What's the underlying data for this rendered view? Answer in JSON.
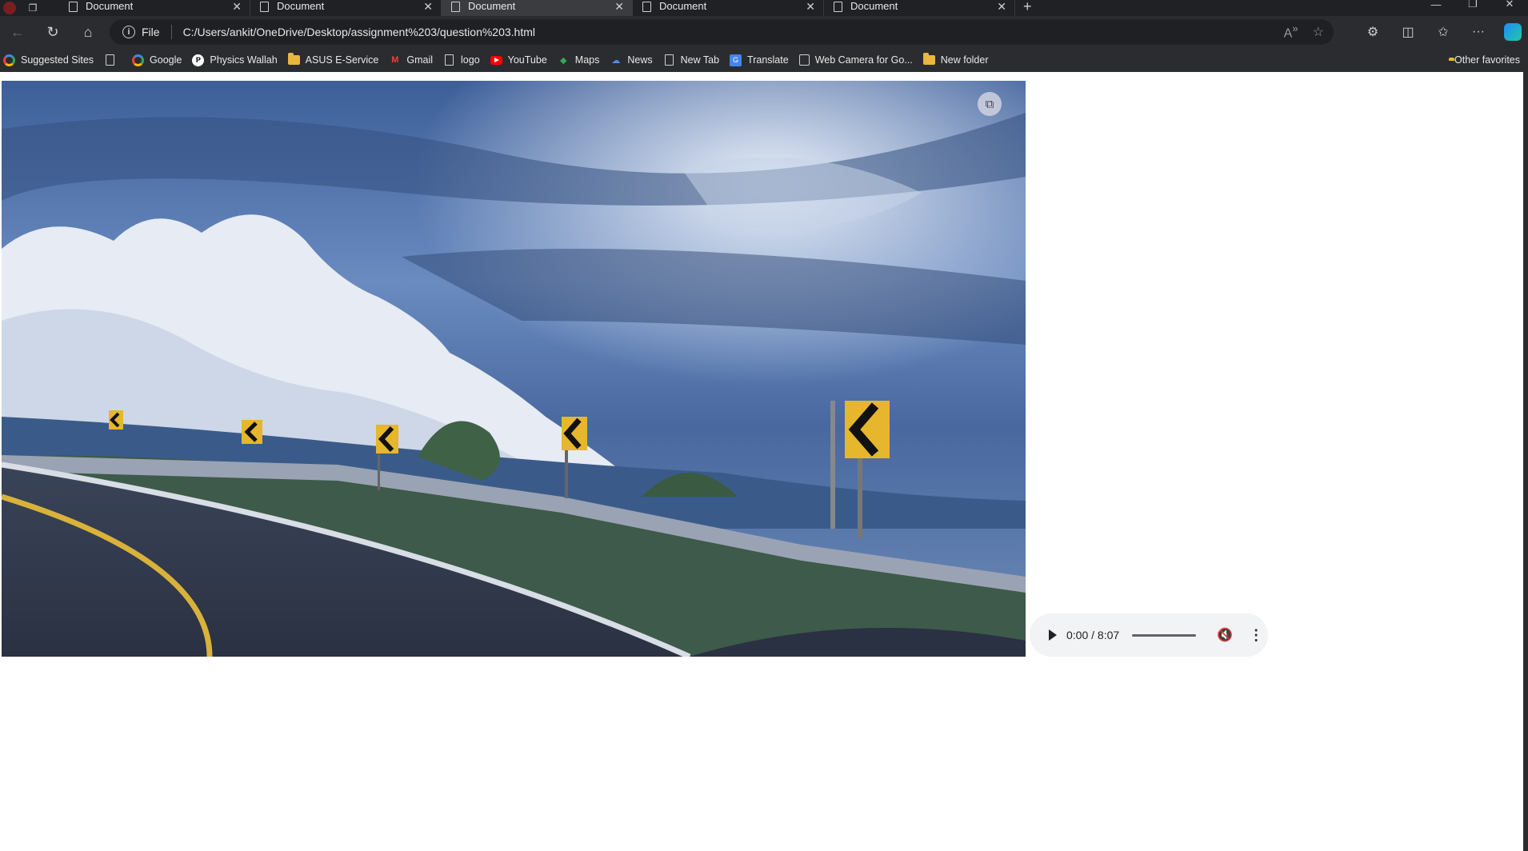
{
  "browser": {
    "tabs": [
      {
        "title": "Document",
        "active": false
      },
      {
        "title": "Document",
        "active": false
      },
      {
        "title": "Document",
        "active": true
      },
      {
        "title": "Document",
        "active": false
      },
      {
        "title": "Document",
        "active": false
      }
    ],
    "address_scheme": "File",
    "address_url": "C:/Users/ankit/OneDrive/Desktop/assignment%203/question%203.html"
  },
  "bookmarks": {
    "items": [
      {
        "label": "Suggested Sites",
        "icon": "google-icon"
      },
      {
        "label": "",
        "icon": "page-icon"
      },
      {
        "label": "Google",
        "icon": "google-icon"
      },
      {
        "label": "Physics Wallah",
        "icon": "pw-icon"
      },
      {
        "label": "ASUS E-Service",
        "icon": "folder-icon"
      },
      {
        "label": "Gmail",
        "icon": "gmail-icon"
      },
      {
        "label": "logo",
        "icon": "page-icon"
      },
      {
        "label": "YouTube",
        "icon": "youtube-icon"
      },
      {
        "label": "Maps",
        "icon": "maps-icon"
      },
      {
        "label": "News",
        "icon": "news-icon"
      },
      {
        "label": "New Tab",
        "icon": "page-icon"
      },
      {
        "label": "Translate",
        "icon": "translate-icon"
      },
      {
        "label": "Web Camera for Go...",
        "icon": "webcam-icon"
      },
      {
        "label": "New folder",
        "icon": "folder-icon"
      }
    ],
    "other": "Other favorites"
  },
  "audio_player": {
    "time": "0:00 / 8:07"
  },
  "colors": {
    "chrome_dark": "#2b2c30",
    "tabbar": "#202124",
    "sky": "#4b6ea8",
    "audio_bg": "#f1f3f4"
  }
}
